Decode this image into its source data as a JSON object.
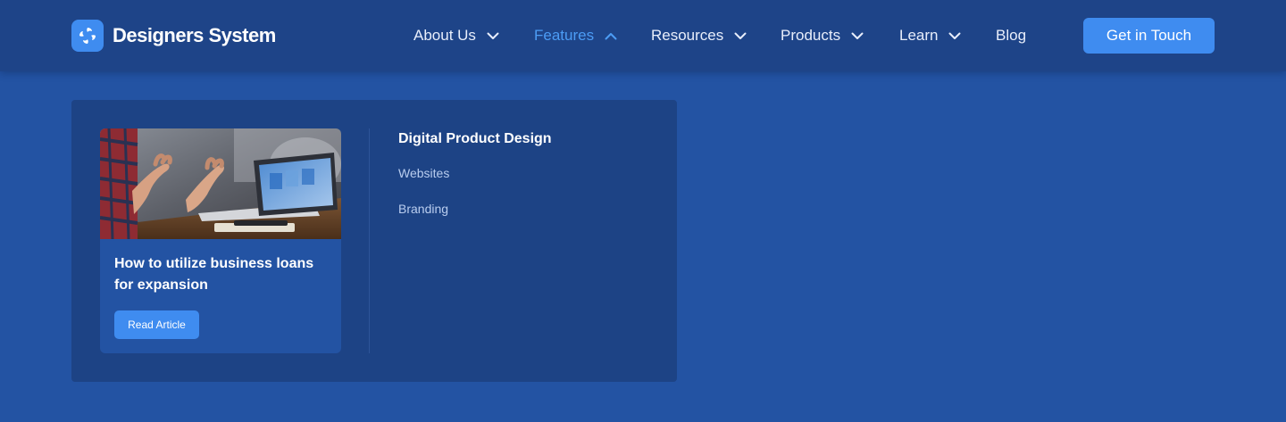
{
  "brand": {
    "name": "Designers System",
    "logo_icon": "spiral-logo-icon"
  },
  "nav": [
    {
      "label": "About Us",
      "has_dropdown": true,
      "open": false
    },
    {
      "label": "Features",
      "has_dropdown": true,
      "open": true
    },
    {
      "label": "Resources",
      "has_dropdown": true,
      "open": false
    },
    {
      "label": "Products",
      "has_dropdown": true,
      "open": false
    },
    {
      "label": "Learn",
      "has_dropdown": true,
      "open": false
    },
    {
      "label": "Blog",
      "has_dropdown": false,
      "open": false
    }
  ],
  "cta": {
    "label": "Get in Touch"
  },
  "dropdown": {
    "card": {
      "image": "laptop-meeting-photo",
      "title": "How to utilize business loans for expansion",
      "button": "Read Article"
    },
    "section": {
      "heading": "Digital Product Design",
      "links": [
        "Websites",
        "Branding"
      ]
    }
  },
  "colors": {
    "page_bg": "#2353a3",
    "header_bg": "#1e4488",
    "panel_bg": "#1d4385",
    "accent": "#3f8cf0",
    "active_nav": "#4c9cf5"
  }
}
